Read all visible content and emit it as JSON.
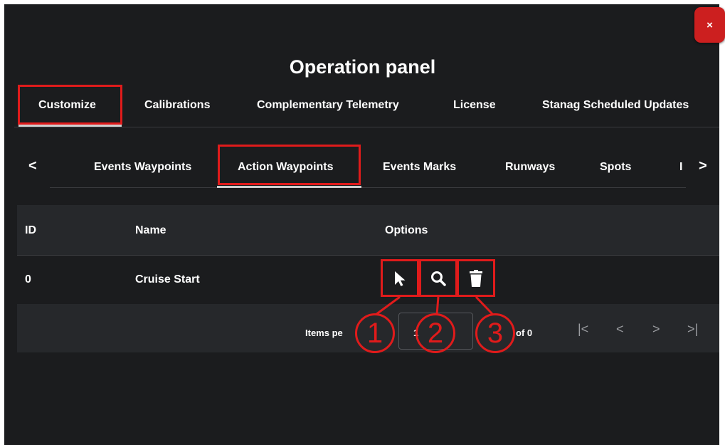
{
  "window": {
    "title": "Operation panel",
    "close_label": "×"
  },
  "main_tabs": [
    {
      "label": "Customize",
      "active": true
    },
    {
      "label": "Calibrations"
    },
    {
      "label": "Complementary Telemetry"
    },
    {
      "label": "License"
    },
    {
      "label": "Stanag Scheduled Updates"
    }
  ],
  "sub_tabs": [
    {
      "label": "Events Waypoints"
    },
    {
      "label": "Action Waypoints",
      "active": true
    },
    {
      "label": "Events Marks"
    },
    {
      "label": "Runways"
    },
    {
      "label": "Spots"
    },
    {
      "label": "I"
    }
  ],
  "nav": {
    "prev": "<",
    "next": ">"
  },
  "table": {
    "headers": [
      "ID",
      "Name",
      "Options"
    ],
    "rows": [
      {
        "id": "0",
        "name": "Cruise Start"
      }
    ]
  },
  "options_icons": [
    "pointer-icon",
    "search-icon",
    "trash-icon"
  ],
  "paginator": {
    "items_per_page_label": "Items pe",
    "page_size_value": "1",
    "range_label": "of 0",
    "first": "|<",
    "prev": "<",
    "next": ">",
    "last": ">|"
  },
  "callouts": [
    "1",
    "2",
    "3"
  ],
  "colors": {
    "panel_bg": "#1b1c1e",
    "header_bg": "#26282b",
    "highlight": "#e01b1b",
    "close_btn": "#cc1f1f"
  }
}
